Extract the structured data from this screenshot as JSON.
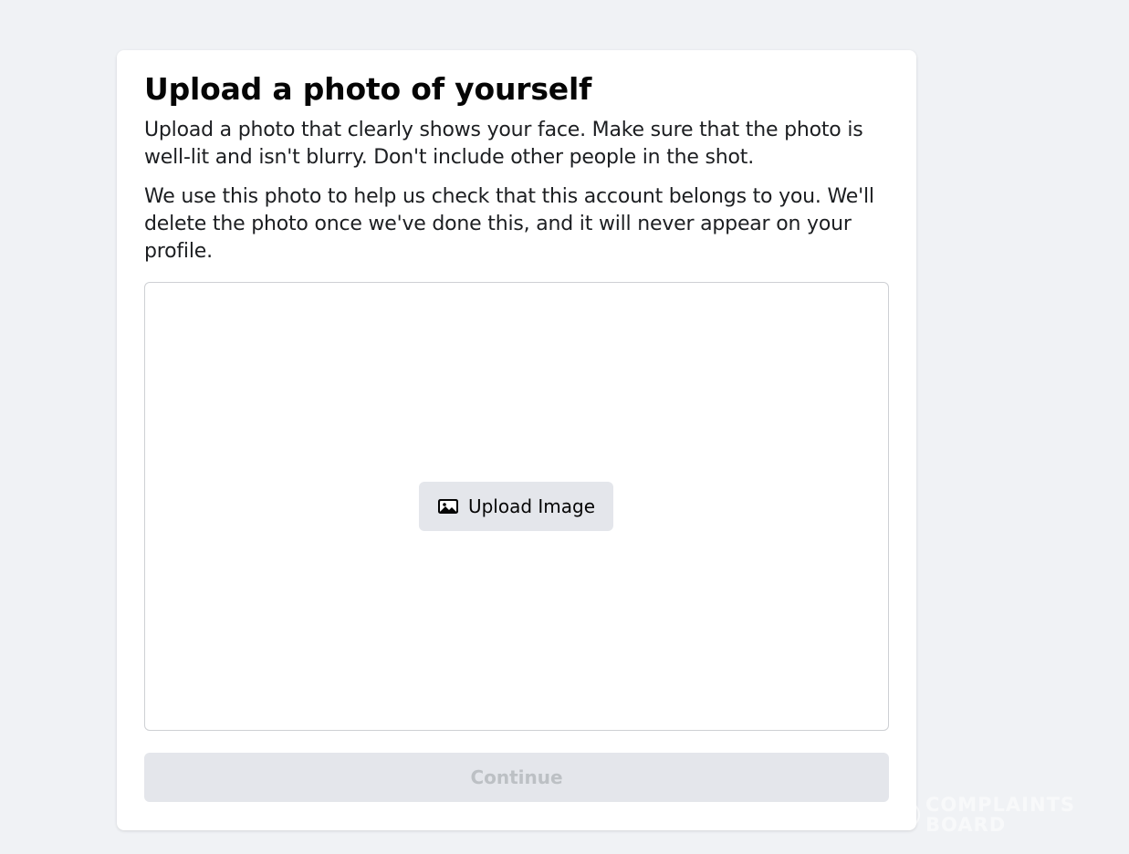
{
  "page": {
    "title": "Upload a photo of yourself",
    "instructions": "Upload a photo that clearly shows your face. Make sure that the photo is well-lit and isn't blurry. Don't include other people in the shot.",
    "privacy_note": "We use this photo to help us check that this account belongs to you. We'll delete the photo once we've done this, and it will never appear on your profile."
  },
  "dropzone": {
    "upload_button_label": "Upload Image",
    "upload_button_icon": "image-icon"
  },
  "actions": {
    "continue_label": "Continue",
    "continue_enabled": false
  },
  "watermark": {
    "line1": "COMPLAINTS",
    "line2": "BOARD"
  },
  "colors": {
    "background": "#f0f2f5",
    "card": "#ffffff",
    "button_bg": "#e4e6eb",
    "disabled_text": "#bcc0c4",
    "border": "#ced0d4"
  }
}
